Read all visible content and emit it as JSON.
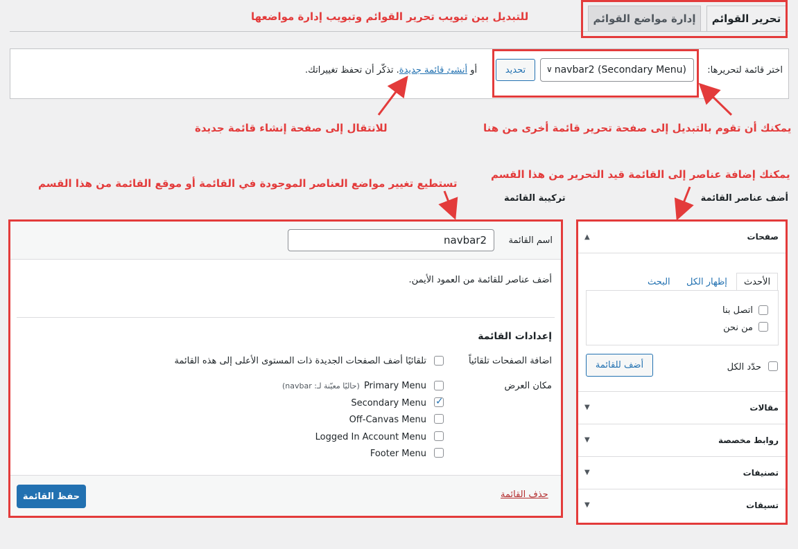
{
  "tabs": {
    "edit_menus": "تحرير القوائم",
    "manage_locations": "إدارة مواضع القوائم"
  },
  "annotations": {
    "tabs_note": "للتبديل بين تبويب تحرير القوائم وتبويب إدارة مواضعها",
    "new_menu_note": "للانتقال إلى صفحة إنشاء قائمة جديدة",
    "switch_menu_note": "يمكنك أن تقوم بالتبديل إلى صفحة تحرير قائمة أخرى من هنا",
    "structure_note": "تستطيع تغيير مواضع العناصر الموجودة في القائمة أو موقع القائمة من هذا القسم",
    "add_items_note": "يمكنك إضافة عناصر إلى القائمة قيد التحرير من هذا القسم"
  },
  "select_bar": {
    "label": "اختر قائمة لتحريرها:",
    "selected": "navbar2 (Secondary Menu)",
    "update_button": "تحديد",
    "or_text": "أو",
    "create_link": "أنشئ قائمة جديدة",
    "save_reminder": ". تذكّر أن تحفظ تغييراتك."
  },
  "left_column": {
    "heading": "أضف عناصر القائمة",
    "pages": {
      "title": "صفحات",
      "tabs": [
        "الأحدث",
        "إظهار الكل",
        "البحث"
      ],
      "items": [
        "اتصل بنا",
        "من نحن"
      ],
      "select_all": "حدّد الكل",
      "add_button": "أضف للقائمة"
    },
    "accordions": [
      "مقالات",
      "روابط مخصصة",
      "تصنيفات",
      "تسيقات"
    ]
  },
  "right_column": {
    "heading": "تركيبة القائمة",
    "name_label": "اسم القائمة",
    "name_value": "navbar2",
    "hint": "أضف عناصر للقائمة من العمود الأيمن.",
    "settings_title": "إعدادات القائمة",
    "auto_add_label": "اضافة الصفحات تلقائياً",
    "auto_add_option": "تلقائيًا أضف الصفحات الجديدة ذات المستوى الأعلى إلى هذه القائمة",
    "display_location_label": "مكان العرض",
    "locations": [
      {
        "name": "Primary Menu",
        "note": "(حاليًا معيّنة لـ: navbar)",
        "checked": false
      },
      {
        "name": "Secondary Menu",
        "note": "",
        "checked": true
      },
      {
        "name": "Off-Canvas Menu",
        "note": "",
        "checked": false
      },
      {
        "name": "Logged In Account Menu",
        "note": "",
        "checked": false
      },
      {
        "name": "Footer Menu",
        "note": "",
        "checked": false
      }
    ],
    "delete_link": "حذف القائمة",
    "save_button": "حفظ القائمة"
  },
  "colors": {
    "annotation_red": "#e33b3b",
    "wp_blue": "#2271b1",
    "background": "#f0f0f1"
  }
}
